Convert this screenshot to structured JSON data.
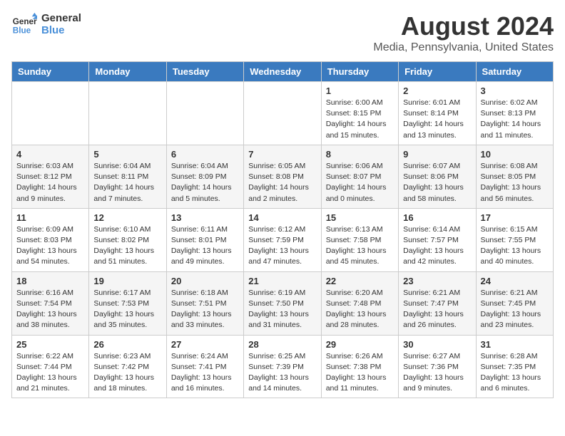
{
  "header": {
    "logo_line1": "General",
    "logo_line2": "Blue",
    "title": "August 2024",
    "subtitle": "Media, Pennsylvania, United States"
  },
  "weekdays": [
    "Sunday",
    "Monday",
    "Tuesday",
    "Wednesday",
    "Thursday",
    "Friday",
    "Saturday"
  ],
  "weeks": [
    [
      {
        "day": "",
        "info": ""
      },
      {
        "day": "",
        "info": ""
      },
      {
        "day": "",
        "info": ""
      },
      {
        "day": "",
        "info": ""
      },
      {
        "day": "1",
        "info": "Sunrise: 6:00 AM\nSunset: 8:15 PM\nDaylight: 14 hours\nand 15 minutes."
      },
      {
        "day": "2",
        "info": "Sunrise: 6:01 AM\nSunset: 8:14 PM\nDaylight: 14 hours\nand 13 minutes."
      },
      {
        "day": "3",
        "info": "Sunrise: 6:02 AM\nSunset: 8:13 PM\nDaylight: 14 hours\nand 11 minutes."
      }
    ],
    [
      {
        "day": "4",
        "info": "Sunrise: 6:03 AM\nSunset: 8:12 PM\nDaylight: 14 hours\nand 9 minutes."
      },
      {
        "day": "5",
        "info": "Sunrise: 6:04 AM\nSunset: 8:11 PM\nDaylight: 14 hours\nand 7 minutes."
      },
      {
        "day": "6",
        "info": "Sunrise: 6:04 AM\nSunset: 8:09 PM\nDaylight: 14 hours\nand 5 minutes."
      },
      {
        "day": "7",
        "info": "Sunrise: 6:05 AM\nSunset: 8:08 PM\nDaylight: 14 hours\nand 2 minutes."
      },
      {
        "day": "8",
        "info": "Sunrise: 6:06 AM\nSunset: 8:07 PM\nDaylight: 14 hours\nand 0 minutes."
      },
      {
        "day": "9",
        "info": "Sunrise: 6:07 AM\nSunset: 8:06 PM\nDaylight: 13 hours\nand 58 minutes."
      },
      {
        "day": "10",
        "info": "Sunrise: 6:08 AM\nSunset: 8:05 PM\nDaylight: 13 hours\nand 56 minutes."
      }
    ],
    [
      {
        "day": "11",
        "info": "Sunrise: 6:09 AM\nSunset: 8:03 PM\nDaylight: 13 hours\nand 54 minutes."
      },
      {
        "day": "12",
        "info": "Sunrise: 6:10 AM\nSunset: 8:02 PM\nDaylight: 13 hours\nand 51 minutes."
      },
      {
        "day": "13",
        "info": "Sunrise: 6:11 AM\nSunset: 8:01 PM\nDaylight: 13 hours\nand 49 minutes."
      },
      {
        "day": "14",
        "info": "Sunrise: 6:12 AM\nSunset: 7:59 PM\nDaylight: 13 hours\nand 47 minutes."
      },
      {
        "day": "15",
        "info": "Sunrise: 6:13 AM\nSunset: 7:58 PM\nDaylight: 13 hours\nand 45 minutes."
      },
      {
        "day": "16",
        "info": "Sunrise: 6:14 AM\nSunset: 7:57 PM\nDaylight: 13 hours\nand 42 minutes."
      },
      {
        "day": "17",
        "info": "Sunrise: 6:15 AM\nSunset: 7:55 PM\nDaylight: 13 hours\nand 40 minutes."
      }
    ],
    [
      {
        "day": "18",
        "info": "Sunrise: 6:16 AM\nSunset: 7:54 PM\nDaylight: 13 hours\nand 38 minutes."
      },
      {
        "day": "19",
        "info": "Sunrise: 6:17 AM\nSunset: 7:53 PM\nDaylight: 13 hours\nand 35 minutes."
      },
      {
        "day": "20",
        "info": "Sunrise: 6:18 AM\nSunset: 7:51 PM\nDaylight: 13 hours\nand 33 minutes."
      },
      {
        "day": "21",
        "info": "Sunrise: 6:19 AM\nSunset: 7:50 PM\nDaylight: 13 hours\nand 31 minutes."
      },
      {
        "day": "22",
        "info": "Sunrise: 6:20 AM\nSunset: 7:48 PM\nDaylight: 13 hours\nand 28 minutes."
      },
      {
        "day": "23",
        "info": "Sunrise: 6:21 AM\nSunset: 7:47 PM\nDaylight: 13 hours\nand 26 minutes."
      },
      {
        "day": "24",
        "info": "Sunrise: 6:21 AM\nSunset: 7:45 PM\nDaylight: 13 hours\nand 23 minutes."
      }
    ],
    [
      {
        "day": "25",
        "info": "Sunrise: 6:22 AM\nSunset: 7:44 PM\nDaylight: 13 hours\nand 21 minutes."
      },
      {
        "day": "26",
        "info": "Sunrise: 6:23 AM\nSunset: 7:42 PM\nDaylight: 13 hours\nand 18 minutes."
      },
      {
        "day": "27",
        "info": "Sunrise: 6:24 AM\nSunset: 7:41 PM\nDaylight: 13 hours\nand 16 minutes."
      },
      {
        "day": "28",
        "info": "Sunrise: 6:25 AM\nSunset: 7:39 PM\nDaylight: 13 hours\nand 14 minutes."
      },
      {
        "day": "29",
        "info": "Sunrise: 6:26 AM\nSunset: 7:38 PM\nDaylight: 13 hours\nand 11 minutes."
      },
      {
        "day": "30",
        "info": "Sunrise: 6:27 AM\nSunset: 7:36 PM\nDaylight: 13 hours\nand 9 minutes."
      },
      {
        "day": "31",
        "info": "Sunrise: 6:28 AM\nSunset: 7:35 PM\nDaylight: 13 hours\nand 6 minutes."
      }
    ]
  ]
}
